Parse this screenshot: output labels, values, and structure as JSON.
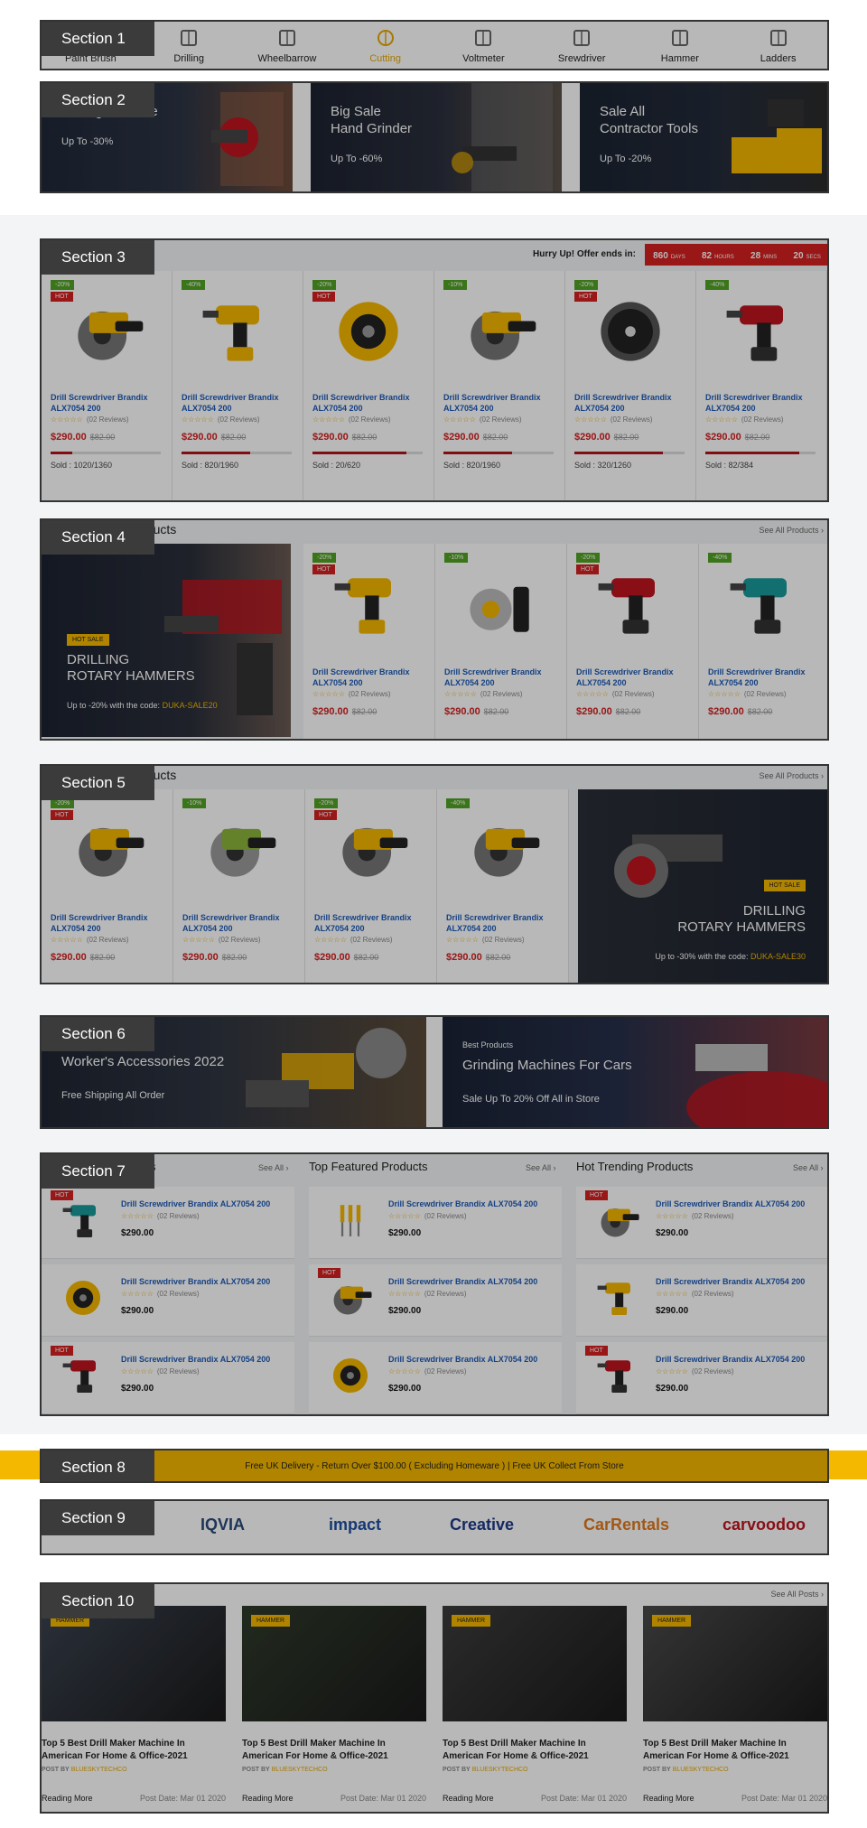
{
  "colors": {
    "accent": "#f5b800",
    "sale_red": "#d52020",
    "link_blue": "#1e5bb8",
    "tag_bg": "#3b3b3b"
  },
  "section_tags": [
    "Section 1",
    "Section 2",
    "Section 3",
    "Section 4",
    "Section 5",
    "Section 6",
    "Section 7",
    "Section 8",
    "Section 9",
    "Section 10"
  ],
  "categories": [
    {
      "label": "Paint Brush",
      "icon": "paint-brush-icon",
      "active": false
    },
    {
      "label": "Drilling",
      "icon": "drill-icon",
      "active": false
    },
    {
      "label": "Wheelbarrow",
      "icon": "wheelbarrow-icon",
      "active": false
    },
    {
      "label": "Cutting",
      "icon": "saw-blade-icon",
      "active": true
    },
    {
      "label": "Voltmeter",
      "icon": "voltmeter-icon",
      "active": false
    },
    {
      "label": "Srewdriver",
      "icon": "screwdriver-icon",
      "active": false
    },
    {
      "label": "Hammer",
      "icon": "hammer-icon",
      "active": false
    },
    {
      "label": "Ladders",
      "icon": "ladder-icon",
      "active": false
    }
  ],
  "promo_banners": [
    {
      "line1": "",
      "line2": "Drilling Machine",
      "sub": "Up To -30%"
    },
    {
      "line1": "Big Sale",
      "line2": "Hand Grinder",
      "sub": "Up To -60%"
    },
    {
      "line1": "Sale All",
      "line2": "Contractor Tools",
      "sub": "Up To -20%"
    }
  ],
  "deals": {
    "title": "y",
    "hurry": "Hurry Up! Offer ends in:",
    "countdown": [
      {
        "v": "860",
        "u": "DAYS"
      },
      {
        "v": "82",
        "u": "HOURS"
      },
      {
        "v": "28",
        "u": "MINS"
      },
      {
        "v": "20",
        "u": "SECS"
      }
    ],
    "products": [
      {
        "discount": "-20%",
        "hot": "HOT",
        "name": "Drill Screwdriver Brandix ALX7054 200",
        "reviews": "(02 Reviews)",
        "price": "$290.00",
        "old": "$82.00",
        "sold": "Sold : 1020/1360",
        "sold_frac": 0.2,
        "img": "circular-saw"
      },
      {
        "discount": "-40%",
        "hot": "",
        "name": "Drill Screwdriver Brandix ALX7054 200",
        "reviews": "(02 Reviews)",
        "price": "$290.00",
        "old": "$82.00",
        "sold": "Sold : 820/1960",
        "sold_frac": 0.62,
        "img": "drill"
      },
      {
        "discount": "-20%",
        "hot": "HOT",
        "name": "Drill Screwdriver Brandix ALX7054 200",
        "reviews": "(02 Reviews)",
        "price": "$290.00",
        "old": "$82.00",
        "sold": "Sold : 20/620",
        "sold_frac": 0.85,
        "img": "disc"
      },
      {
        "discount": "-10%",
        "hot": "",
        "name": "Drill Screwdriver Brandix ALX7054 200",
        "reviews": "(02 Reviews)",
        "price": "$290.00",
        "old": "$82.00",
        "sold": "Sold : 820/1960",
        "sold_frac": 0.62,
        "img": "circular-saw"
      },
      {
        "discount": "-20%",
        "hot": "HOT",
        "name": "Drill Screwdriver Brandix ALX7054 200",
        "reviews": "(02 Reviews)",
        "price": "$290.00",
        "old": "$82.00",
        "sold": "Sold : 320/1260",
        "sold_frac": 0.8,
        "img": "blade"
      },
      {
        "discount": "-40%",
        "hot": "",
        "name": "Drill Screwdriver Brandix ALX7054 200",
        "reviews": "(02 Reviews)",
        "price": "$290.00",
        "old": "$82.00",
        "sold": "Sold : 82/384",
        "sold_frac": 0.85,
        "img": "red-drill"
      }
    ]
  },
  "sec4": {
    "title": "oducts",
    "see_all": "See All Products",
    "banner": {
      "badge": "HOT SALE",
      "line1": "DRILLING",
      "line2": "ROTARY HAMMERS",
      "sub": "Up to -20% with the code:",
      "code": "DUKA-SALE20"
    },
    "products": [
      {
        "discount": "-20%",
        "hot": "HOT",
        "name": "Drill Screwdriver Brandix ALX7054 200",
        "reviews": "(02 Reviews)",
        "price": "$290.00",
        "old": "$82.00",
        "img": "drill"
      },
      {
        "discount": "-10%",
        "hot": "",
        "name": "Drill Screwdriver Brandix ALX7054 200",
        "reviews": "(02 Reviews)",
        "price": "$290.00",
        "old": "$82.00",
        "img": "chalk"
      },
      {
        "discount": "-20%",
        "hot": "HOT",
        "name": "Drill Screwdriver Brandix ALX7054 200",
        "reviews": "(02 Reviews)",
        "price": "$290.00",
        "old": "$82.00",
        "img": "red-drill"
      },
      {
        "discount": "-40%",
        "hot": "",
        "name": "Drill Screwdriver Brandix ALX7054 200",
        "reviews": "(02 Reviews)",
        "price": "$290.00",
        "old": "$82.00",
        "img": "teal-drill"
      }
    ]
  },
  "sec5": {
    "title": "oducts",
    "see_all": "See All Products",
    "banner": {
      "badge": "HOT SALE",
      "line1": "DRILLING",
      "line2": "ROTARY HAMMERS",
      "sub": "Up to -30% with the code:",
      "code": "DUKA-SALE30"
    },
    "products": [
      {
        "discount": "-20%",
        "hot": "HOT",
        "name": "Drill Screwdriver Brandix ALX7054 200",
        "reviews": "(02 Reviews)",
        "price": "$290.00",
        "old": "$82.00",
        "img": "circular-saw"
      },
      {
        "discount": "-10%",
        "hot": "",
        "name": "Drill Screwdriver Brandix ALX7054 200",
        "reviews": "(02 Reviews)",
        "price": "$290.00",
        "old": "$82.00",
        "img": "gray-saw"
      },
      {
        "discount": "-20%",
        "hot": "HOT",
        "name": "Drill Screwdriver Brandix ALX7054 200",
        "reviews": "(02 Reviews)",
        "price": "$290.00",
        "old": "$82.00",
        "img": "circular-saw"
      },
      {
        "discount": "-40%",
        "hot": "",
        "name": "Drill Screwdriver Brandix ALX7054 200",
        "reviews": "(02 Reviews)",
        "price": "$290.00",
        "old": "$82.00",
        "img": "circular-saw"
      }
    ]
  },
  "sec6": {
    "left": {
      "title": "Worker's Accessories 2022",
      "sub": "Free Shipping All Order"
    },
    "right": {
      "kicker": "Best Products",
      "title": "Grinding Machines For Cars",
      "sub": "Sale Up To 20% Off  All in Store"
    }
  },
  "sec7": {
    "columns": [
      {
        "title": "s",
        "see_all": "See All",
        "items": [
          {
            "hot": "HOT",
            "name": "Drill Screwdriver Brandix ALX7054 200",
            "reviews": "(02 Reviews)",
            "price": "$290.00",
            "img": "teal-drill"
          },
          {
            "hot": "",
            "name": "Drill Screwdriver Brandix ALX7054 200",
            "reviews": "(02 Reviews)",
            "price": "$290.00",
            "img": "disc"
          },
          {
            "hot": "HOT",
            "name": "Drill Screwdriver Brandix ALX7054 200",
            "reviews": "(02 Reviews)",
            "price": "$290.00",
            "img": "red-drill"
          }
        ]
      },
      {
        "title": "Top Featured Products",
        "see_all": "See All",
        "items": [
          {
            "hot": "",
            "name": "Drill Screwdriver Brandix ALX7054 200",
            "reviews": "(02 Reviews)",
            "price": "$290.00",
            "img": "screwdrivers"
          },
          {
            "hot": "HOT",
            "name": "Drill Screwdriver Brandix ALX7054 200",
            "reviews": "(02 Reviews)",
            "price": "$290.00",
            "img": "circular-saw"
          },
          {
            "hot": "",
            "name": "Drill Screwdriver Brandix ALX7054 200",
            "reviews": "(02 Reviews)",
            "price": "$290.00",
            "img": "disc"
          }
        ]
      },
      {
        "title": "Hot Trending Products",
        "see_all": "See All",
        "items": [
          {
            "hot": "HOT",
            "name": "Drill Screwdriver Brandix ALX7054 200",
            "reviews": "(02 Reviews)",
            "price": "$290.00",
            "img": "circular-saw"
          },
          {
            "hot": "",
            "name": "Drill Screwdriver Brandix ALX7054 200",
            "reviews": "(02 Reviews)",
            "price": "$290.00",
            "img": "drill"
          },
          {
            "hot": "HOT",
            "name": "Drill Screwdriver Brandix ALX7054 200",
            "reviews": "(02 Reviews)",
            "price": "$290.00",
            "img": "red-drill"
          }
        ]
      }
    ]
  },
  "sec8": {
    "text": "Free UK Delivery - Return Over $100.00 ( Excluding Homeware )  |  Free UK Collect From Store"
  },
  "sec9": {
    "logos": [
      {
        "text": "IQVIA",
        "color": "#2a4a7a"
      },
      {
        "text": "impact",
        "color": "#1e4fa0"
      },
      {
        "text": "Creative",
        "color": "#1e3a8a"
      },
      {
        "text": "CarRentals",
        "color": "#e07a1f"
      },
      {
        "text": "carvoodoo",
        "color": "#c0141e"
      }
    ]
  },
  "sec10": {
    "see_all": "See All Posts",
    "posts": [
      {
        "tag": "HAMMER",
        "title": "Top 5 Best Drill Maker Machine In American For Home & Office-2021",
        "by": "POST BY",
        "author": "BLUESKYTECHCO",
        "more": "Reading More",
        "date": "Post Date: Mar 01 2020"
      },
      {
        "tag": "HAMMER",
        "title": "Top 5 Best Drill Maker Machine In American For Home & Office-2021",
        "by": "POST BY",
        "author": "BLUESKYTECHCO",
        "more": "Reading More",
        "date": "Post Date: Mar 01 2020"
      },
      {
        "tag": "HAMMER",
        "title": "Top 5 Best Drill Maker Machine In American For Home & Office-2021",
        "by": "POST BY",
        "author": "BLUESKYTECHCO",
        "more": "Reading More",
        "date": "Post Date: Mar 01 2020"
      },
      {
        "tag": "HAMMER",
        "title": "Top 5 Best Drill Maker Machine In American For Home & Office-2021",
        "by": "POST BY",
        "author": "BLUESKYTECHCO",
        "more": "Reading More",
        "date": "Post Date: Mar 01 2020"
      }
    ]
  }
}
